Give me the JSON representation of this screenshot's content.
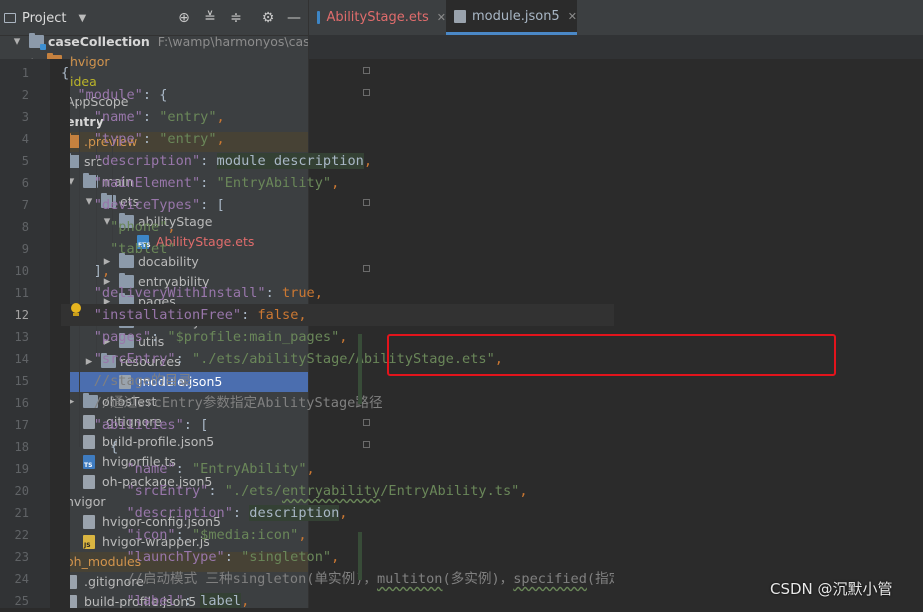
{
  "project_panel": {
    "title": "Project",
    "tree": [
      {
        "label": "caseCollection",
        "path": "F:\\wamp\\harmonyos\\caseCollec",
        "bold": true,
        "arrow": "down",
        "icon": "module",
        "depth": 0
      },
      {
        "label": ".hvigor",
        "arrow": "right",
        "icon": "folder-orange",
        "color": "orange",
        "depth": 1
      },
      {
        "label": ".idea",
        "arrow": "right",
        "icon": "folder-orange",
        "color": "yellow",
        "depth": 1
      },
      {
        "label": "AppScope",
        "arrow": "right",
        "icon": "folder",
        "depth": 1
      },
      {
        "label": "entry",
        "bold": true,
        "arrow": "down",
        "icon": "module",
        "depth": 1
      },
      {
        "label": ".preview",
        "arrow": "right",
        "icon": "folder-orange",
        "color": "orange",
        "depth": 2,
        "excluded": true
      },
      {
        "label": "src",
        "arrow": "down",
        "icon": "folder",
        "depth": 2
      },
      {
        "label": "main",
        "arrow": "down",
        "icon": "folder",
        "depth": 3
      },
      {
        "label": "ets",
        "arrow": "down",
        "icon": "folder",
        "depth": 4
      },
      {
        "label": "abilityStage",
        "arrow": "down",
        "icon": "folder",
        "depth": 5
      },
      {
        "label": "AbilityStage.ets",
        "icon": "file-ets",
        "color": "red",
        "depth": 6
      },
      {
        "label": "docability",
        "arrow": "right",
        "icon": "folder",
        "depth": 5
      },
      {
        "label": "entryability",
        "arrow": "right",
        "icon": "folder",
        "depth": 5
      },
      {
        "label": "pages",
        "arrow": "right",
        "icon": "folder",
        "depth": 5
      },
      {
        "label": "testability",
        "arrow": "right",
        "icon": "folder",
        "depth": 5
      },
      {
        "label": "utils",
        "arrow": "right",
        "icon": "folder",
        "depth": 5
      },
      {
        "label": "resources",
        "arrow": "right",
        "icon": "folder",
        "depth": 4
      },
      {
        "label": "module.json5",
        "icon": "file-gear",
        "depth": 5,
        "selected": true
      },
      {
        "label": "ohosTest",
        "arrow": "right",
        "icon": "folder",
        "depth": 3
      },
      {
        "label": ".gitignore",
        "icon": "file-gear",
        "depth": 3
      },
      {
        "label": "build-profile.json5",
        "icon": "file-gear",
        "depth": 3
      },
      {
        "label": "hvigorfile.ts",
        "icon": "file-ts",
        "depth": 3
      },
      {
        "label": "oh-package.json5",
        "icon": "file-gear",
        "depth": 3
      },
      {
        "label": "hvigor",
        "arrow": "down",
        "icon": "folder",
        "depth": 1
      },
      {
        "label": "hvigor-config.json5",
        "icon": "file-gear",
        "depth": 3
      },
      {
        "label": "hvigor-wrapper.js",
        "icon": "file-js",
        "depth": 3
      },
      {
        "label": "oh_modules",
        "arrow": "right",
        "icon": "folder-orange",
        "color": "orange",
        "depth": 1,
        "excluded": true
      },
      {
        "label": ".gitignore",
        "icon": "file-gear",
        "depth": 2
      },
      {
        "label": "build-profile.json5",
        "icon": "file-gear",
        "depth": 2
      }
    ]
  },
  "tabs": [
    {
      "label": "AbilityStage.ets",
      "icon": "file-ets",
      "color": "#e06c6c",
      "active": false
    },
    {
      "label": "module.json5",
      "icon": "file-gear",
      "color": "#a9b7c6",
      "active": true
    }
  ],
  "editor": {
    "current_line": 12,
    "lines": [
      {
        "n": 1,
        "tokens": [
          {
            "t": "{",
            "c": "p"
          }
        ]
      },
      {
        "n": 2,
        "tokens": [
          {
            "t": "  "
          },
          {
            "t": "\"module\"",
            "c": "k"
          },
          {
            "t": ": {",
            "c": "p"
          }
        ]
      },
      {
        "n": 3,
        "tokens": [
          {
            "t": "    "
          },
          {
            "t": "\"name\"",
            "c": "k"
          },
          {
            "t": ": ",
            "c": "p"
          },
          {
            "t": "\"entry\"",
            "c": "s"
          },
          {
            "t": ",",
            "c": "kw"
          }
        ]
      },
      {
        "n": 4,
        "tokens": [
          {
            "t": "    "
          },
          {
            "t": "\"type\"",
            "c": "k"
          },
          {
            "t": ": ",
            "c": "p"
          },
          {
            "t": "\"entry\"",
            "c": "s"
          },
          {
            "t": ",",
            "c": "kw"
          }
        ]
      },
      {
        "n": 5,
        "tokens": [
          {
            "t": "    "
          },
          {
            "t": "\"description\"",
            "c": "k"
          },
          {
            "t": ": ",
            "c": "p"
          },
          {
            "t": "module description",
            "c": "p hl"
          },
          {
            "t": ",",
            "c": "kw"
          }
        ]
      },
      {
        "n": 6,
        "tokens": [
          {
            "t": "    "
          },
          {
            "t": "\"mainElement\"",
            "c": "k"
          },
          {
            "t": ": ",
            "c": "p"
          },
          {
            "t": "\"EntryAbility\"",
            "c": "s"
          },
          {
            "t": ",",
            "c": "kw"
          }
        ]
      },
      {
        "n": 7,
        "tokens": [
          {
            "t": "    "
          },
          {
            "t": "\"deviceTypes\"",
            "c": "k"
          },
          {
            "t": ": [",
            "c": "p"
          }
        ]
      },
      {
        "n": 8,
        "tokens": [
          {
            "t": "      "
          },
          {
            "t": "\"phone\"",
            "c": "s"
          },
          {
            "t": ",",
            "c": "kw"
          }
        ]
      },
      {
        "n": 9,
        "tokens": [
          {
            "t": "      "
          },
          {
            "t": "\"tablet\"",
            "c": "s"
          }
        ]
      },
      {
        "n": 10,
        "tokens": [
          {
            "t": "    "
          },
          {
            "t": "]",
            "c": "p"
          },
          {
            "t": ",",
            "c": "kw"
          }
        ]
      },
      {
        "n": 11,
        "tokens": [
          {
            "t": "    "
          },
          {
            "t": "\"deliveryWithInstall\"",
            "c": "k"
          },
          {
            "t": ": ",
            "c": "p"
          },
          {
            "t": "true",
            "c": "kw"
          },
          {
            "t": ",",
            "c": "kw"
          }
        ]
      },
      {
        "n": 12,
        "tokens": [
          {
            "t": "    "
          },
          {
            "t": "\"installationFree\"",
            "c": "k"
          },
          {
            "t": ": ",
            "c": "p"
          },
          {
            "t": "false",
            "c": "kw"
          },
          {
            "t": ",",
            "c": "kw"
          }
        ]
      },
      {
        "n": 13,
        "tokens": [
          {
            "t": "    "
          },
          {
            "t": "\"pages\"",
            "c": "k"
          },
          {
            "t": ": ",
            "c": "p"
          },
          {
            "t": "\"$profile:main_pages\"",
            "c": "s"
          },
          {
            "t": ",",
            "c": "kw"
          }
        ]
      },
      {
        "n": 14,
        "tokens": [
          {
            "t": "    "
          },
          {
            "t": "\"srcEntry\"",
            "c": "k"
          },
          {
            "t": ": ",
            "c": "p"
          },
          {
            "t": "\"./ets/abilityStage/AbilityStage.ets\"",
            "c": "s"
          },
          {
            "t": ",",
            "c": "kw"
          }
        ]
      },
      {
        "n": 15,
        "tokens": [
          {
            "t": "    "
          },
          {
            "t": "//stage的目录",
            "c": "cm"
          }
        ]
      },
      {
        "n": 16,
        "tokens": [
          {
            "t": "    "
          },
          {
            "t": "//通过srcEntry参数指定AbilityStage路径",
            "c": "cm"
          }
        ]
      },
      {
        "n": 17,
        "tokens": [
          {
            "t": "    "
          },
          {
            "t": "\"abilities\"",
            "c": "k"
          },
          {
            "t": ": [",
            "c": "p"
          }
        ]
      },
      {
        "n": 18,
        "tokens": [
          {
            "t": "      "
          },
          {
            "t": "{",
            "c": "p"
          }
        ]
      },
      {
        "n": 19,
        "tokens": [
          {
            "t": "        "
          },
          {
            "t": "\"name\"",
            "c": "k"
          },
          {
            "t": ": ",
            "c": "p"
          },
          {
            "t": "\"EntryAbility\"",
            "c": "s"
          },
          {
            "t": ",",
            "c": "kw"
          }
        ]
      },
      {
        "n": 20,
        "tokens": [
          {
            "t": "        "
          },
          {
            "t": "\"srcEntry\"",
            "c": "k"
          },
          {
            "t": ": ",
            "c": "p"
          },
          {
            "t": "\"./ets/",
            "c": "s"
          },
          {
            "t": "entryability",
            "c": "s sq"
          },
          {
            "t": "/EntryAbility.ts\"",
            "c": "s"
          },
          {
            "t": ",",
            "c": "kw"
          }
        ]
      },
      {
        "n": 21,
        "tokens": [
          {
            "t": "        "
          },
          {
            "t": "\"description\"",
            "c": "k"
          },
          {
            "t": ": ",
            "c": "p"
          },
          {
            "t": "description",
            "c": "p hl"
          },
          {
            "t": ",",
            "c": "kw"
          }
        ]
      },
      {
        "n": 22,
        "tokens": [
          {
            "t": "        "
          },
          {
            "t": "\"icon\"",
            "c": "k"
          },
          {
            "t": ": ",
            "c": "p"
          },
          {
            "t": "\"$media:icon\"",
            "c": "s"
          },
          {
            "t": ",",
            "c": "kw"
          }
        ]
      },
      {
        "n": 23,
        "tokens": [
          {
            "t": "        "
          },
          {
            "t": "\"launchType\"",
            "c": "k"
          },
          {
            "t": ": ",
            "c": "p"
          },
          {
            "t": "\"singleton\"",
            "c": "s"
          },
          {
            "t": ",",
            "c": "kw"
          }
        ]
      },
      {
        "n": 24,
        "tokens": [
          {
            "t": "        "
          },
          {
            "t": "//启动模式 三种singleton(单实例)，",
            "c": "cm"
          },
          {
            "t": "multiton",
            "c": "cm sq"
          },
          {
            "t": "(多实例)，",
            "c": "cm"
          },
          {
            "t": "specified",
            "c": "cm sq"
          },
          {
            "t": "(指定实",
            "c": "cm"
          }
        ]
      },
      {
        "n": 25,
        "tokens": [
          {
            "t": "        "
          },
          {
            "t": "\"label\"",
            "c": "k"
          },
          {
            "t": ": ",
            "c": "p"
          },
          {
            "t": "label",
            "c": "p hl"
          },
          {
            "t": ",",
            "c": "kw"
          }
        ]
      }
    ]
  },
  "annotation_color": "#e3141c",
  "watermark": "CSDN @沉默小管"
}
